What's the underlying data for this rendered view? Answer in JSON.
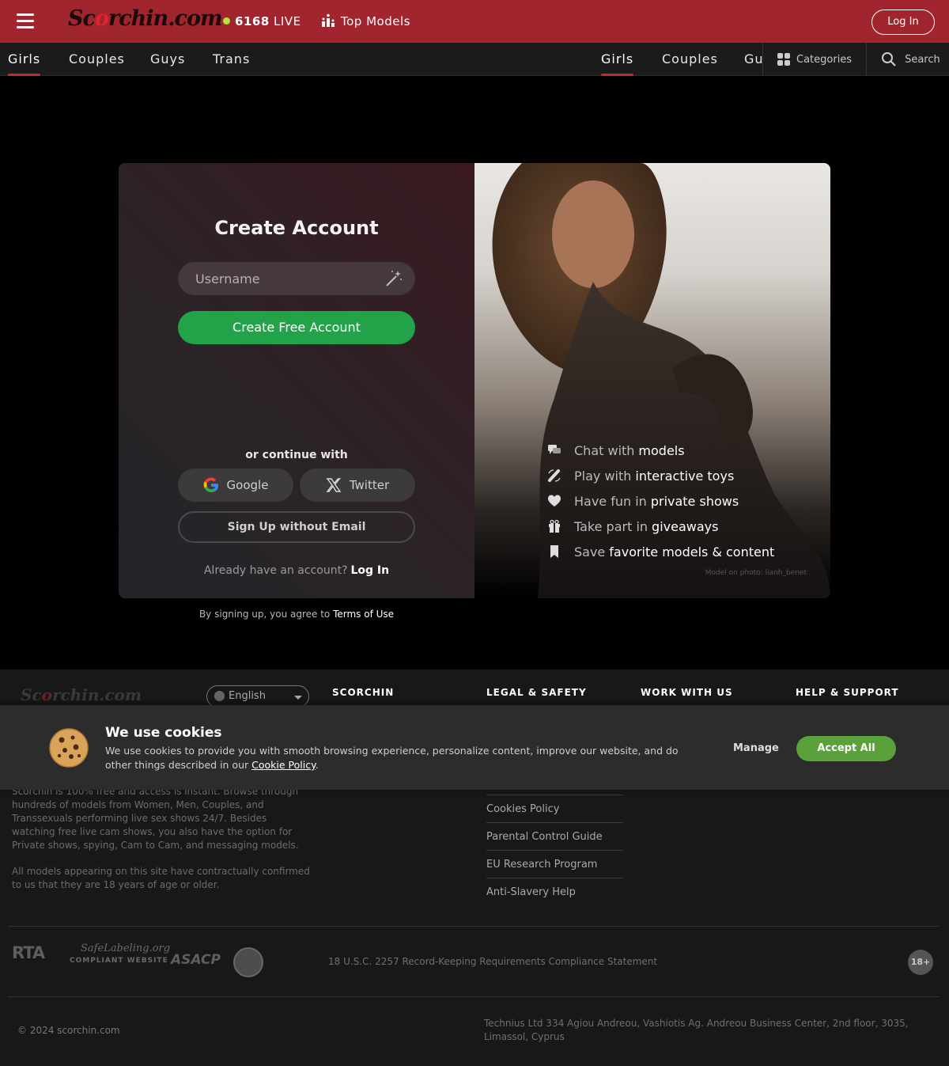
{
  "header": {
    "logo": "Scorchin.com",
    "live_count": "6168",
    "live_label": "LIVE",
    "top_models": "Top Models",
    "login": "Log In"
  },
  "nav": {
    "left_tabs": [
      "Girls",
      "Couples",
      "Guys",
      "Trans"
    ],
    "right_tabs": [
      "Girls",
      "Couples",
      "Gu"
    ],
    "categories": "Categories",
    "search": "Search"
  },
  "signup": {
    "title": "Create Account",
    "username_placeholder": "Username",
    "create_button": "Create Free Account",
    "continue_with": "or continue with",
    "google": "Google",
    "twitter": "Twitter",
    "no_email": "Sign Up without Email",
    "already": "Already have an account?",
    "login_link": "Log In",
    "terms_prefix": "By signing up, you agree to",
    "terms_link": "Terms of Use"
  },
  "features": [
    {
      "pre": "Chat with",
      "bold": "models",
      "icon": "chat-icon"
    },
    {
      "pre": "Play with",
      "bold": "interactive toys",
      "icon": "toy-icon"
    },
    {
      "pre": "Have fun in",
      "bold": "private shows",
      "icon": "heart-icon"
    },
    {
      "pre": "Take part in",
      "bold": "giveaways",
      "icon": "gift-icon"
    },
    {
      "pre": "Save",
      "bold": "favorite models & content",
      "icon": "bookmark-icon"
    }
  ],
  "photo_credit": "Model on photo: lianh_benet",
  "footer": {
    "logo": "Scorchin.com",
    "language": "English",
    "headings": [
      "SCORCHIN",
      "LEGAL & SAFETY",
      "WORK WITH US",
      "HELP & SUPPORT"
    ],
    "description": "Scorchin is 100% free and access is instant. Browse through hundreds of models from Women, Men, Couples, and Transsexuals performing live sex shows 24/7. Besides watching free live cam shows, you also have the option for Private shows, spying, Cam to Cam, and messaging models.",
    "age_notice": "All models appearing on this site have contractually confirmed to us that they are 18 years of age or older.",
    "legal_links": [
      "Cookies Policy",
      "Parental Control Guide",
      "EU Research Program",
      "Anti-Slavery Help"
    ],
    "badges": {
      "rta": "RTA",
      "safelabeling": "SafeLabeling.org",
      "safelabeling_sub": "COMPLIANT WEBSITE",
      "asacp": "ASACP"
    },
    "usc": "18 U.S.C. 2257 Record-Keeping Requirements Compliance Statement",
    "age_badge": "18+",
    "copyright": "© 2024 scorchin.com",
    "address": "Technius Ltd 334 Agiou Andreou, Vashiotis Ag. Andreou Business Center, 2nd floor, 3035, Limassol, Cyprus"
  },
  "cookie": {
    "title": "We use cookies",
    "text": "We use cookies to provide you with smooth browsing experience, personalize content, improve our website, and do other things described in our",
    "link": "Cookie Policy",
    "manage": "Manage",
    "accept": "Accept All"
  },
  "colors": {
    "brand": "#a0252f",
    "cta": "#22a34a",
    "accept": "#5aa03b",
    "live_dot": "#b9e33a"
  }
}
